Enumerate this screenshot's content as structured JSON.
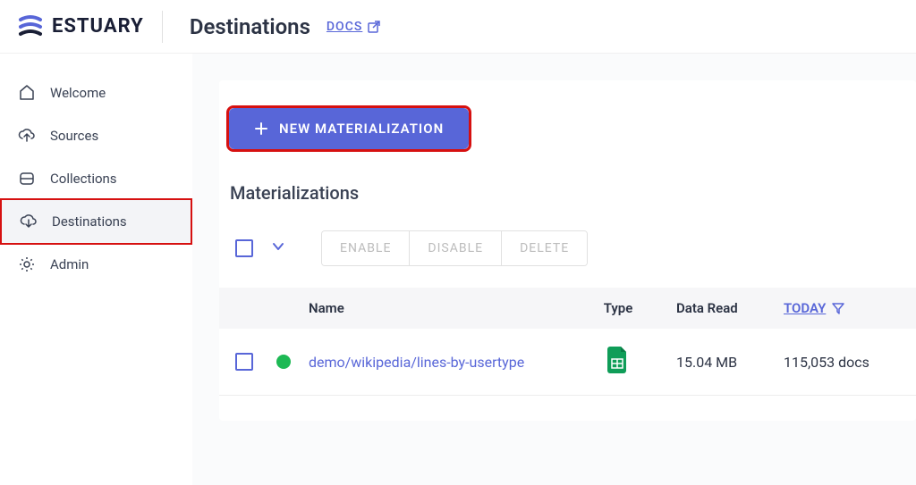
{
  "brand": "ESTUARY",
  "header": {
    "title": "Destinations",
    "docs_label": "DOCS"
  },
  "sidebar": {
    "items": [
      {
        "label": "Welcome"
      },
      {
        "label": "Sources"
      },
      {
        "label": "Collections"
      },
      {
        "label": "Destinations"
      },
      {
        "label": "Admin"
      }
    ]
  },
  "main": {
    "new_btn": "NEW MATERIALIZATION",
    "section_heading": "Materializations",
    "actions": {
      "enable": "ENABLE",
      "disable": "DISABLE",
      "delete": "DELETE"
    },
    "table": {
      "headers": {
        "name": "Name",
        "type": "Type",
        "data_read": "Data Read",
        "today": "TODAY"
      },
      "rows": [
        {
          "name": "demo/wikipedia/lines-by-usertype",
          "type_icon": "google-sheets",
          "data_read": "15.04 MB",
          "docs": "115,053 docs"
        }
      ]
    }
  }
}
